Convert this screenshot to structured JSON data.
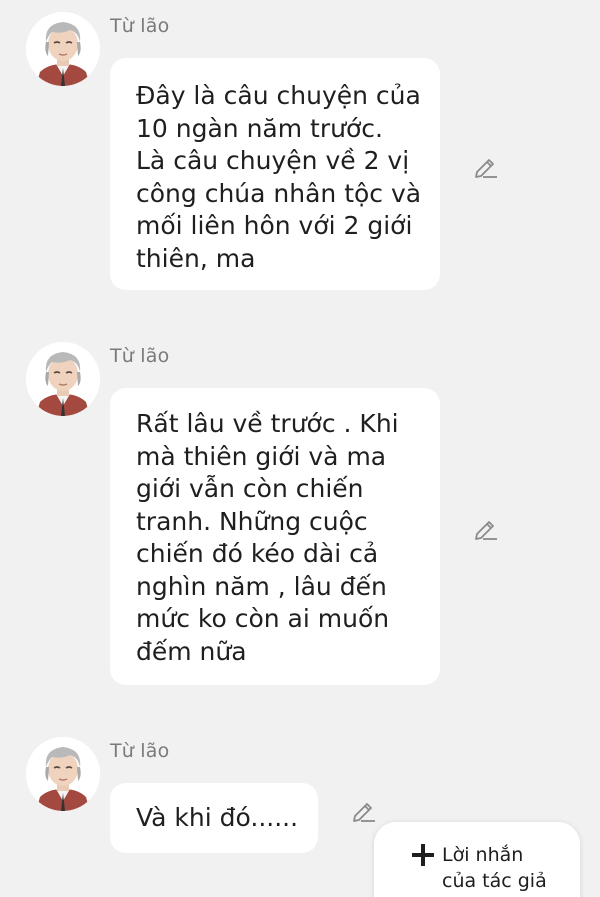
{
  "messages": [
    {
      "sender": "Từ lão",
      "text": "Đây là câu chuyện của\n10 ngàn năm trước.\nLà câu chuyện về 2 vị\ncông chúa nhân tộc và\nmối liên hôn với 2 giới\nthiên, ma",
      "avatar_icon": "elderly-man-avatar-icon",
      "edit_icon": "pencil-icon"
    },
    {
      "sender": "Từ lão",
      "text": "Rất lâu về trước . Khi\nmà thiên giới và ma\ngiới vẫn còn chiến\ntranh. Những cuộc\nchiến đó kéo dài cả\nnghìn năm , lâu đến\nmức ko còn ai muốn\nđếm nữa",
      "avatar_icon": "elderly-man-avatar-icon",
      "edit_icon": "pencil-icon"
    },
    {
      "sender": "Từ lão",
      "text": "Và khi đó......",
      "avatar_icon": "elderly-man-avatar-icon",
      "edit_icon": "pencil-icon"
    }
  ],
  "author_note_button": {
    "label": "Lời nhắn\ncủa tác giả",
    "icon": "plus-icon"
  },
  "colors": {
    "background": "#f1f1f1",
    "bubble": "#ffffff",
    "sender_text": "#7a7a7a",
    "message_text": "#1f1f1f"
  }
}
